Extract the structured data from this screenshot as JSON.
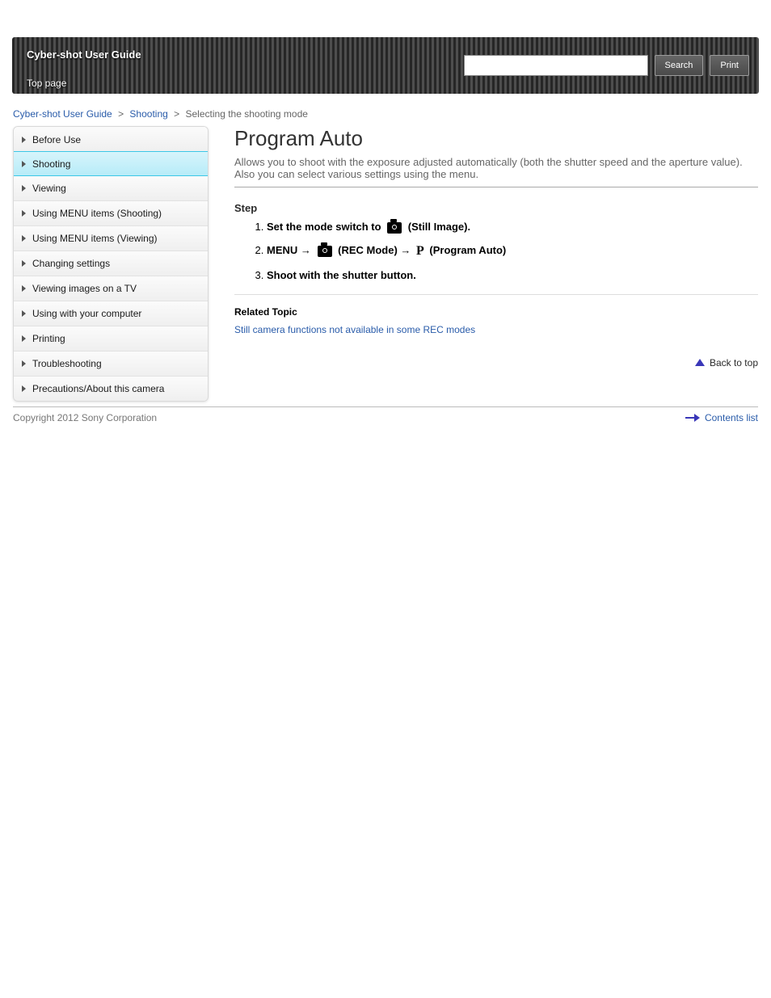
{
  "header": {
    "brand": "Cyber-shot User Guide",
    "menu": [
      "Top page"
    ],
    "search_placeholder": "",
    "search_button": "Search",
    "print_button": "Print"
  },
  "breadcrumb": [
    "Cyber-shot User Guide",
    "Shooting",
    "Selecting the shooting mode"
  ],
  "sidebar": {
    "items": [
      "Before Use",
      "Shooting",
      "Viewing",
      "Using MENU items (Shooting)",
      "Using MENU items (Viewing)",
      "Changing settings",
      "Viewing images on a TV",
      "Using with your computer",
      "Printing",
      "Troubleshooting",
      "Precautions/About this camera"
    ],
    "active_index": 1
  },
  "content": {
    "title": "Program Auto",
    "subtitle": "Allows you to shoot with the exposure adjusted automatically (both the shutter speed and the aperture value). Also you can select various settings using the menu.",
    "section_title": "Step",
    "steps": [
      {
        "pre": "Set the mode switch to ",
        "icon": "camera",
        "post": " (Still Image)."
      },
      {
        "pre": "MENU → ",
        "icon": "camera",
        "post1": " (REC Mode) → ",
        "icon2": "P",
        "post2": " (Program Auto)"
      },
      {
        "pre": "Shoot with the shutter button."
      }
    ],
    "related_title": "Related Topic",
    "related_links": [
      "Still camera functions not available in some REC modes"
    ]
  },
  "back_to_top": "Back to top",
  "footer": {
    "copyright": "Copyright 2012 Sony Corporation",
    "bookmark": "Contents list"
  }
}
